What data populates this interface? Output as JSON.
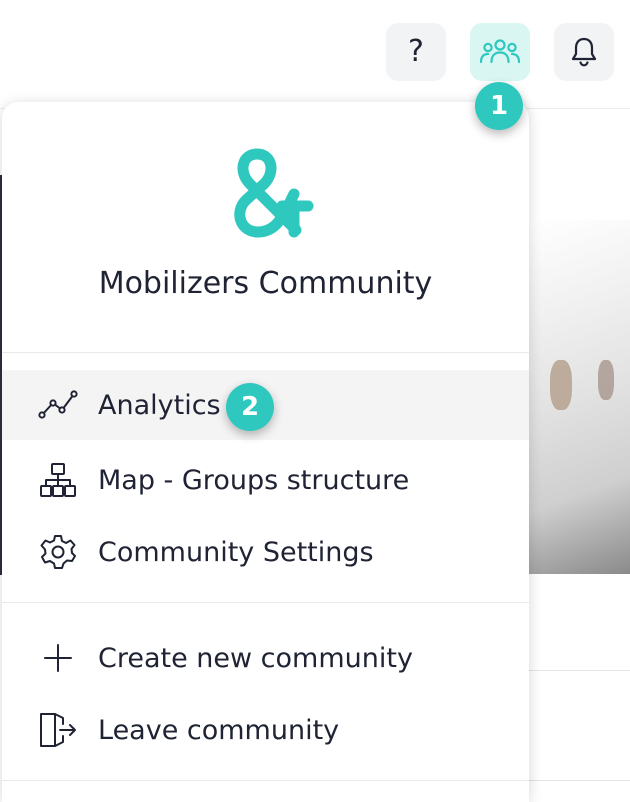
{
  "topbar": {
    "help_label": "?",
    "icons": [
      "question-icon",
      "people-group-icon",
      "bell-icon"
    ]
  },
  "dropdown": {
    "community_name": "Mobilizers Community",
    "logo_icon": "ampersand-logo-icon",
    "menu_items": [
      {
        "label": "Analytics",
        "icon": "analytics-line-icon",
        "active": true
      },
      {
        "label": "Map - Groups structure",
        "icon": "org-chart-icon"
      },
      {
        "label": "Community Settings",
        "icon": "gear-icon"
      },
      {
        "label": "Create new community",
        "icon": "plus-icon"
      },
      {
        "label": "Leave community",
        "icon": "exit-door-icon"
      }
    ]
  },
  "callouts": {
    "step_1": "1",
    "step_2": "2"
  },
  "colors": {
    "accent": "#2ec8bf",
    "accent_light": "#d9f6f3",
    "text": "#1f2333"
  }
}
